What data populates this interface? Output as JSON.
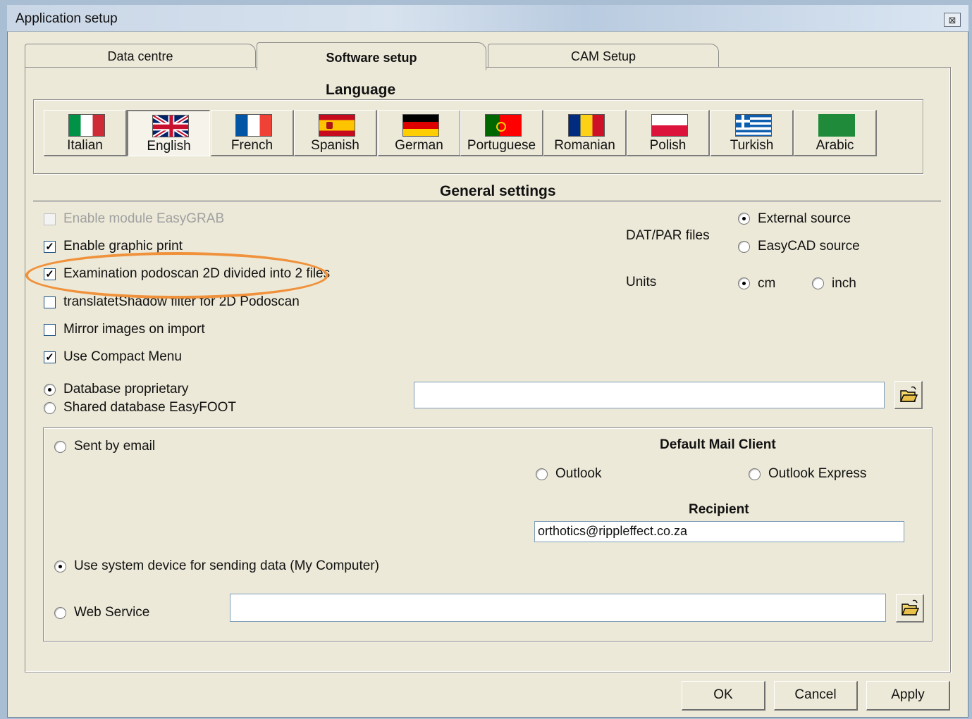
{
  "window": {
    "title": "Application setup",
    "close_symbol": "⊠"
  },
  "tabs": [
    {
      "label": "Data centre",
      "active": false
    },
    {
      "label": "Software setup",
      "active": true
    },
    {
      "label": "CAM Setup",
      "active": false
    }
  ],
  "language": {
    "heading": "Language",
    "items": [
      {
        "label": "Italian",
        "flag": "italy-flag",
        "selected": false
      },
      {
        "label": "English",
        "flag": "uk-flag",
        "selected": true
      },
      {
        "label": "French",
        "flag": "france-flag",
        "selected": false
      },
      {
        "label": "Spanish",
        "flag": "spain-flag",
        "selected": false
      },
      {
        "label": "German",
        "flag": "germany-flag",
        "selected": false
      },
      {
        "label": "Portuguese",
        "flag": "portugal-flag",
        "selected": false
      },
      {
        "label": "Romanian",
        "flag": "romania-flag",
        "selected": false
      },
      {
        "label": "Polish",
        "flag": "poland-flag",
        "selected": false
      },
      {
        "label": "Turkish",
        "flag": "greece-flag",
        "selected": false
      },
      {
        "label": "Arabic",
        "flag": "green-flag",
        "selected": false
      }
    ]
  },
  "general": {
    "heading": "General settings",
    "checkboxes": [
      {
        "label": "Enable module EasyGRAB",
        "checked": false,
        "disabled": true
      },
      {
        "label": "Enable graphic print",
        "checked": true,
        "disabled": false
      },
      {
        "label": "Examination podoscan 2D divided into 2 files",
        "checked": true,
        "disabled": false
      },
      {
        "label": "translatetShadow filter for 2D Podoscan",
        "checked": false,
        "disabled": false
      },
      {
        "label": "Mirror images on import",
        "checked": false,
        "disabled": false
      },
      {
        "label": "Use Compact Menu",
        "checked": true,
        "disabled": false
      }
    ],
    "dat_par": {
      "label": "DAT/PAR files",
      "options": [
        "External source",
        "EasyCAD source"
      ],
      "selected": "External source"
    },
    "units": {
      "label": "Units",
      "options": [
        "cm",
        "inch"
      ],
      "selected": "cm"
    },
    "database": {
      "options": [
        "Database proprietary",
        "Shared database EasyFOOT"
      ],
      "selected": "Database proprietary",
      "path_value": ""
    }
  },
  "sending": {
    "sent_by_email": "Sent by email",
    "mail_client_heading": "Default Mail Client",
    "mail_clients": [
      "Outlook",
      "Outlook Express"
    ],
    "recipient_heading": "Recipient",
    "recipient_value": "orthotics@rippleffect.co.za",
    "system_device": "Use system device for sending data (My Computer)",
    "web_service": "Web Service",
    "web_service_value": "",
    "selected": "system_device"
  },
  "buttons": {
    "ok": "OK",
    "cancel": "Cancel",
    "apply": "Apply"
  },
  "colors": {
    "highlight": "#f0913b",
    "dialog_bg": "#ece9d8"
  }
}
